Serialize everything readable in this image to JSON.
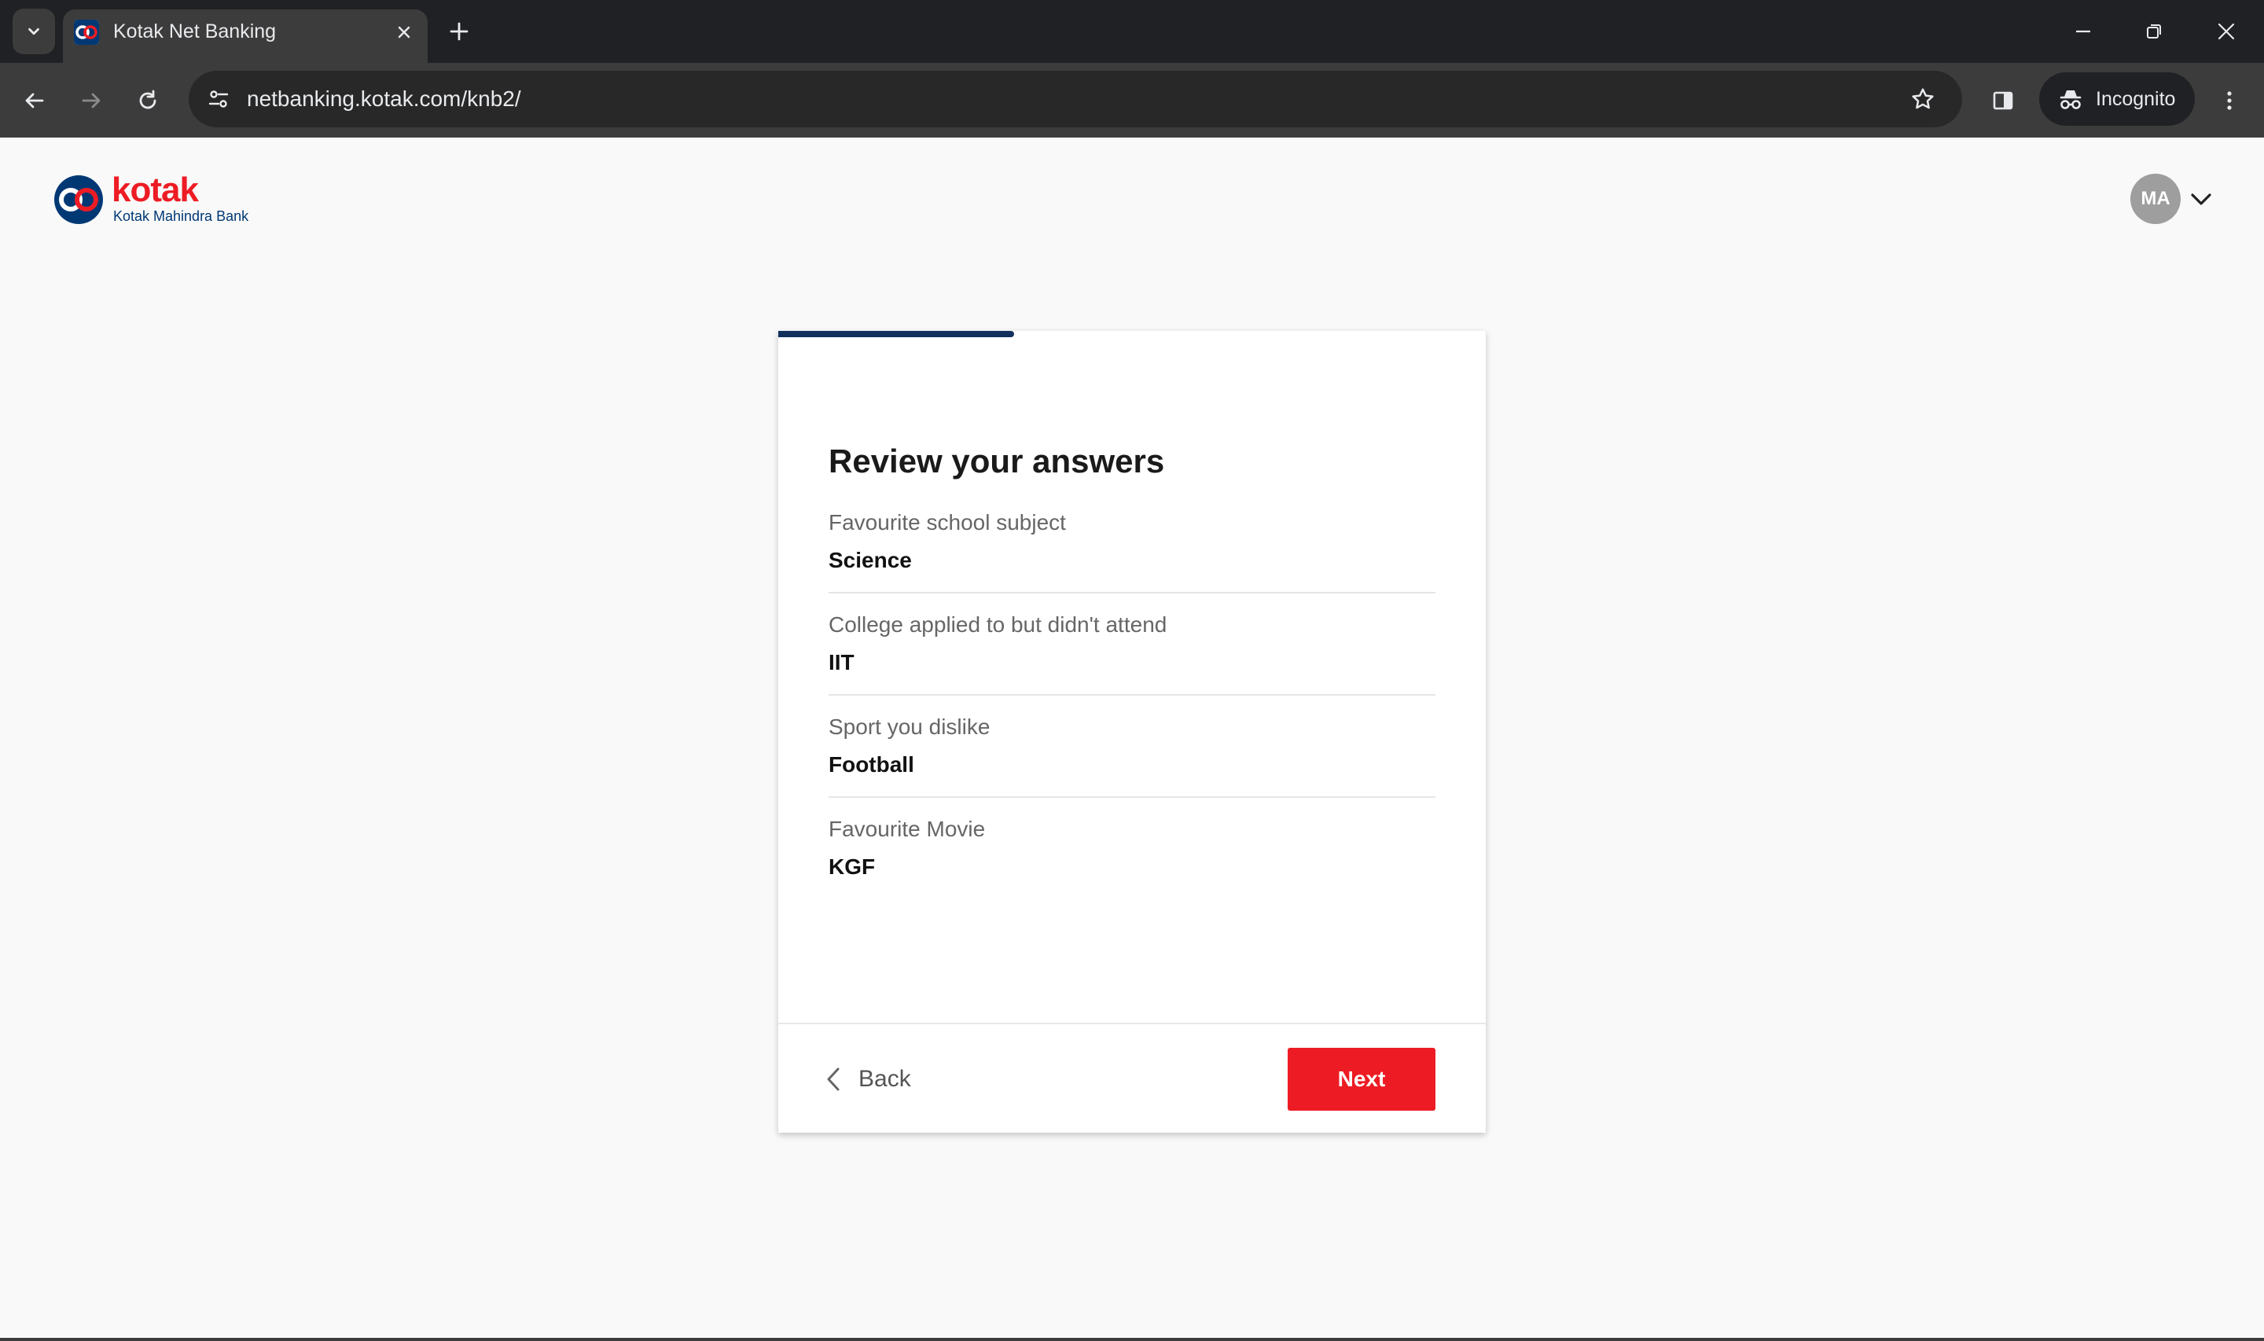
{
  "browser": {
    "tab_title": "Kotak Net Banking",
    "url": "netbanking.kotak.com/knb2/",
    "incognito_label": "Incognito"
  },
  "header": {
    "logo_word": "kotak",
    "logo_subtitle": "Kotak Mahindra Bank",
    "avatar_initials": "MA"
  },
  "card": {
    "progress_fraction": 0.333,
    "title": "Review your answers",
    "items": [
      {
        "question": "Favourite school subject",
        "answer": "Science"
      },
      {
        "question": "College applied to but didn't attend",
        "answer": "IIT"
      },
      {
        "question": "Sport you dislike",
        "answer": "Football"
      },
      {
        "question": "Favourite Movie",
        "answer": "KGF"
      }
    ],
    "back_label": "Back",
    "next_label": "Next"
  },
  "colors": {
    "brand_red": "#ed1c24",
    "brand_navy": "#003874",
    "progress": "#12315e"
  }
}
